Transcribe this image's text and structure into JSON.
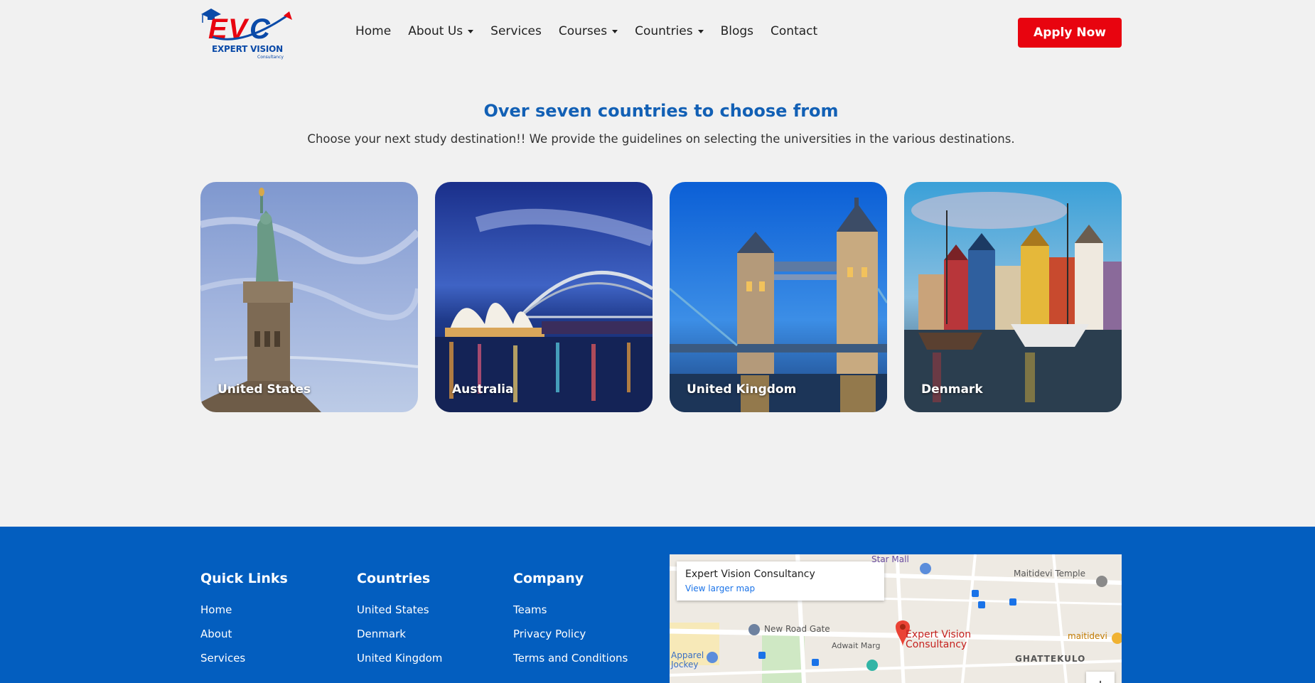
{
  "brand": {
    "logo_letters": "EVC",
    "name": "EXPERT VISION",
    "tagline": "Consultancy"
  },
  "nav": {
    "items": [
      {
        "label": "Home",
        "dropdown": false
      },
      {
        "label": "About Us",
        "dropdown": true
      },
      {
        "label": "Services",
        "dropdown": false
      },
      {
        "label": "Courses",
        "dropdown": true
      },
      {
        "label": "Countries",
        "dropdown": true
      },
      {
        "label": "Blogs",
        "dropdown": false
      },
      {
        "label": "Contact",
        "dropdown": false
      }
    ],
    "apply_label": "Apply Now"
  },
  "section": {
    "title": "Over seven countries to choose from",
    "description": "Choose your next study destination!! We provide the guidelines on selecting the universities in the various destinations."
  },
  "countries": [
    {
      "name": "United States"
    },
    {
      "name": "Australia"
    },
    {
      "name": "United Kingdom"
    },
    {
      "name": "Denmark"
    }
  ],
  "footer": {
    "quick_links": {
      "heading": "Quick Links",
      "items": [
        "Home",
        "About",
        "Services"
      ]
    },
    "countries": {
      "heading": "Countries",
      "items": [
        "United States",
        "Denmark",
        "United Kingdom"
      ]
    },
    "company": {
      "heading": "Company",
      "items": [
        "Teams",
        "Privacy Policy",
        "Terms and Conditions"
      ]
    }
  },
  "map": {
    "place_name": "Expert Vision Consultancy",
    "view_larger": "View larger map",
    "labels": {
      "new_road_gate": "New Road Gate",
      "adwait_marg": "Adwait Marg",
      "maitidevi_temple": "Maitidevi Temple",
      "maitidevi": "maitidevi",
      "ghattekulo": "GHATTEKULO",
      "star_mall": "Star Mall",
      "apparel_jockey": "Apparel Jockey",
      "pin_label": "Expert Vision Consultancy"
    },
    "zoom_in": "+"
  },
  "colors": {
    "brand_blue": "#035ebf",
    "title_blue": "#1260b5",
    "accent_red": "#e8040f"
  }
}
